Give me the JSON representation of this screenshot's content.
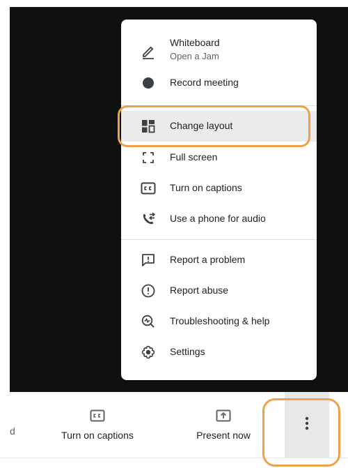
{
  "bottom_bar": {
    "partial_label": "d",
    "captions_label": "Turn on captions",
    "present_label": "Present now"
  },
  "menu": {
    "items": [
      {
        "label": "Whiteboard",
        "sublabel": "Open a Jam",
        "icon": "pencil-icon"
      },
      {
        "label": "Record meeting",
        "icon": "record-icon"
      },
      {
        "label": "Change layout",
        "icon": "layout-icon"
      },
      {
        "label": "Full screen",
        "icon": "fullscreen-icon"
      },
      {
        "label": "Turn on captions",
        "icon": "captions-icon"
      },
      {
        "label": "Use a phone for audio",
        "icon": "phone-audio-icon"
      },
      {
        "label": "Report a problem",
        "icon": "report-problem-icon"
      },
      {
        "label": "Report abuse",
        "icon": "report-abuse-icon"
      },
      {
        "label": "Troubleshooting & help",
        "icon": "troubleshooting-icon"
      },
      {
        "label": "Settings",
        "icon": "settings-icon"
      }
    ]
  },
  "colors": {
    "stage_background": "#111111",
    "highlight_orange": "#f0a04b",
    "menu_active_background": "#ebebeb",
    "more_button_background": "#e8e8e8"
  }
}
